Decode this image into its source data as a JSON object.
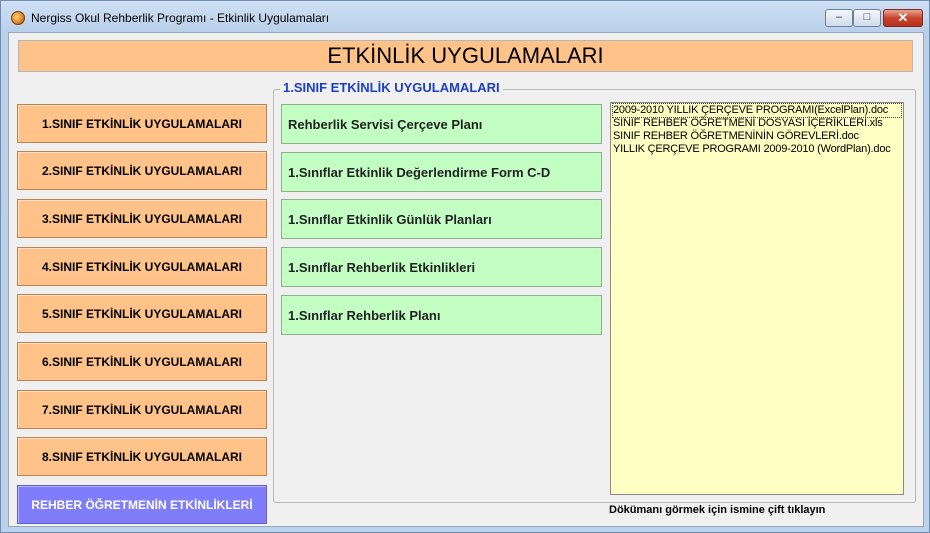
{
  "window": {
    "title": "Nergiss Okul Rehberlik Programı - Etkinlik Uygulamaları",
    "minimize": "–",
    "maximize": "□",
    "close": "✕"
  },
  "header": {
    "title": "ETKİNLİK UYGULAMALARI"
  },
  "sidebar": {
    "items": [
      {
        "label": "1.SINIF ETKİNLİK UYGULAMALARI"
      },
      {
        "label": "2.SINIF ETKİNLİK UYGULAMALARI"
      },
      {
        "label": "3.SINIF ETKİNLİK UYGULAMALARI"
      },
      {
        "label": "4.SINIF ETKİNLİK UYGULAMALARI"
      },
      {
        "label": "5.SINIF ETKİNLİK UYGULAMALARI"
      },
      {
        "label": "6.SINIF ETKİNLİK UYGULAMALARI"
      },
      {
        "label": "7.SINIF ETKİNLİK UYGULAMALARI"
      },
      {
        "label": "8.SINIF ETKİNLİK UYGULAMALARI"
      }
    ],
    "teacher_button": "REHBER ÖĞRETMENİN ETKİNLİKLERİ"
  },
  "group": {
    "legend": "1.SINIF ETKİNLİK UYGULAMALARI",
    "buttons": [
      {
        "label": "Rehberlik Servisi Çerçeve Planı"
      },
      {
        "label": "1.Sınıflar Etkinlik Değerlendirme Form C-D"
      },
      {
        "label": "1.Sınıflar Etkinlik Günlük Planları"
      },
      {
        "label": "1.Sınıflar Rehberlik Etkinlikleri"
      },
      {
        "label": "1.Sınıflar Rehberlik Planı"
      }
    ],
    "files": [
      "2009-2010 YILLIK  ÇERÇEVE PROGRAMI(ExcelPlan).doc",
      "SINIF REHBER ÖĞRETMENİ DOSYASI İÇERİKLERİ.xls",
      "SINIF REHBER ÖĞRETMENİNİN GÖREVLERİ.doc",
      "YILLIK  ÇERÇEVE PROGRAMI 2009-2010 (WordPlan).doc"
    ],
    "hint": "Dökümanı görmek için ismine çift tıklayın"
  },
  "colors": {
    "orange": "#ffc389",
    "green": "#c3ffc3",
    "teacher": "#7f7dfa",
    "list_bg": "#ffffc3",
    "legend": "#1d3fc7"
  }
}
